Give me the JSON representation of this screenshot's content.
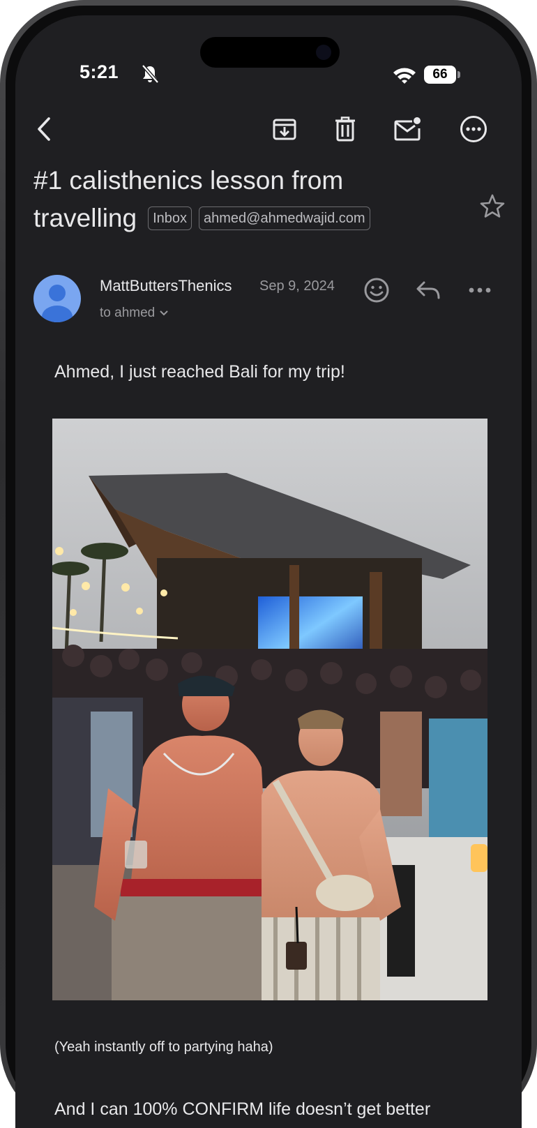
{
  "status_bar": {
    "time": "5:21",
    "battery": "66",
    "icons": [
      "bell-off-icon",
      "wifi-icon",
      "battery-icon"
    ]
  },
  "toolbar": {
    "icons": [
      "back-icon",
      "archive-icon",
      "delete-icon",
      "mark-unread-icon",
      "more-options-icon"
    ]
  },
  "email": {
    "subject_line1": "#1 calisthenics lesson from",
    "subject_line2": "travelling",
    "labels": [
      "Inbox",
      "ahmed@ahmedwajid.com"
    ],
    "starred": false,
    "sender_name": "MattButtersThenics",
    "date": "Sep 9, 2024",
    "to_line": "to ahmed",
    "body_line1": "Ahmed, I just reached Bali for my trip!",
    "photo_caption": "(Yeah instantly off to partying haha)",
    "body_line3": "And I can 100% CONFIRM life doesn’t get better"
  },
  "colors": {
    "background": "#1f1f22",
    "text_primary": "#e8e8ea",
    "text_secondary": "#9a9a9e",
    "avatar": "#7aa6f0"
  }
}
